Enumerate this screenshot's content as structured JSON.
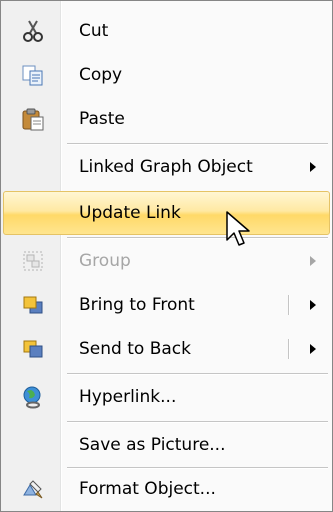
{
  "menu": {
    "items": [
      {
        "label": "Cut",
        "icon": "scissors-icon"
      },
      {
        "label": "Copy",
        "icon": "copy-icon"
      },
      {
        "label": "Paste",
        "icon": "paste-icon"
      },
      {
        "label": "Linked Graph Object",
        "submenu": true
      },
      {
        "label": "Update Link",
        "highlighted": true
      },
      {
        "label": "Group",
        "icon": "group-icon",
        "disabled": true,
        "submenu": true
      },
      {
        "label": "Bring to Front",
        "icon": "bring-to-front-icon",
        "submenu": true,
        "split": true
      },
      {
        "label": "Send to Back",
        "icon": "send-to-back-icon",
        "submenu": true,
        "split": true
      },
      {
        "label": "Hyperlink...",
        "icon": "hyperlink-globe-icon"
      },
      {
        "label": "Save as Picture..."
      },
      {
        "label": "Format Object...",
        "icon": "format-object-icon"
      }
    ]
  },
  "colors": {
    "highlight": "#ffd968",
    "highlight_border": "#e5c365",
    "gutter": "#f0f0f0",
    "disabled_text": "#a6a6a6"
  },
  "cursor": {
    "icon": "mouse-pointer-icon"
  }
}
